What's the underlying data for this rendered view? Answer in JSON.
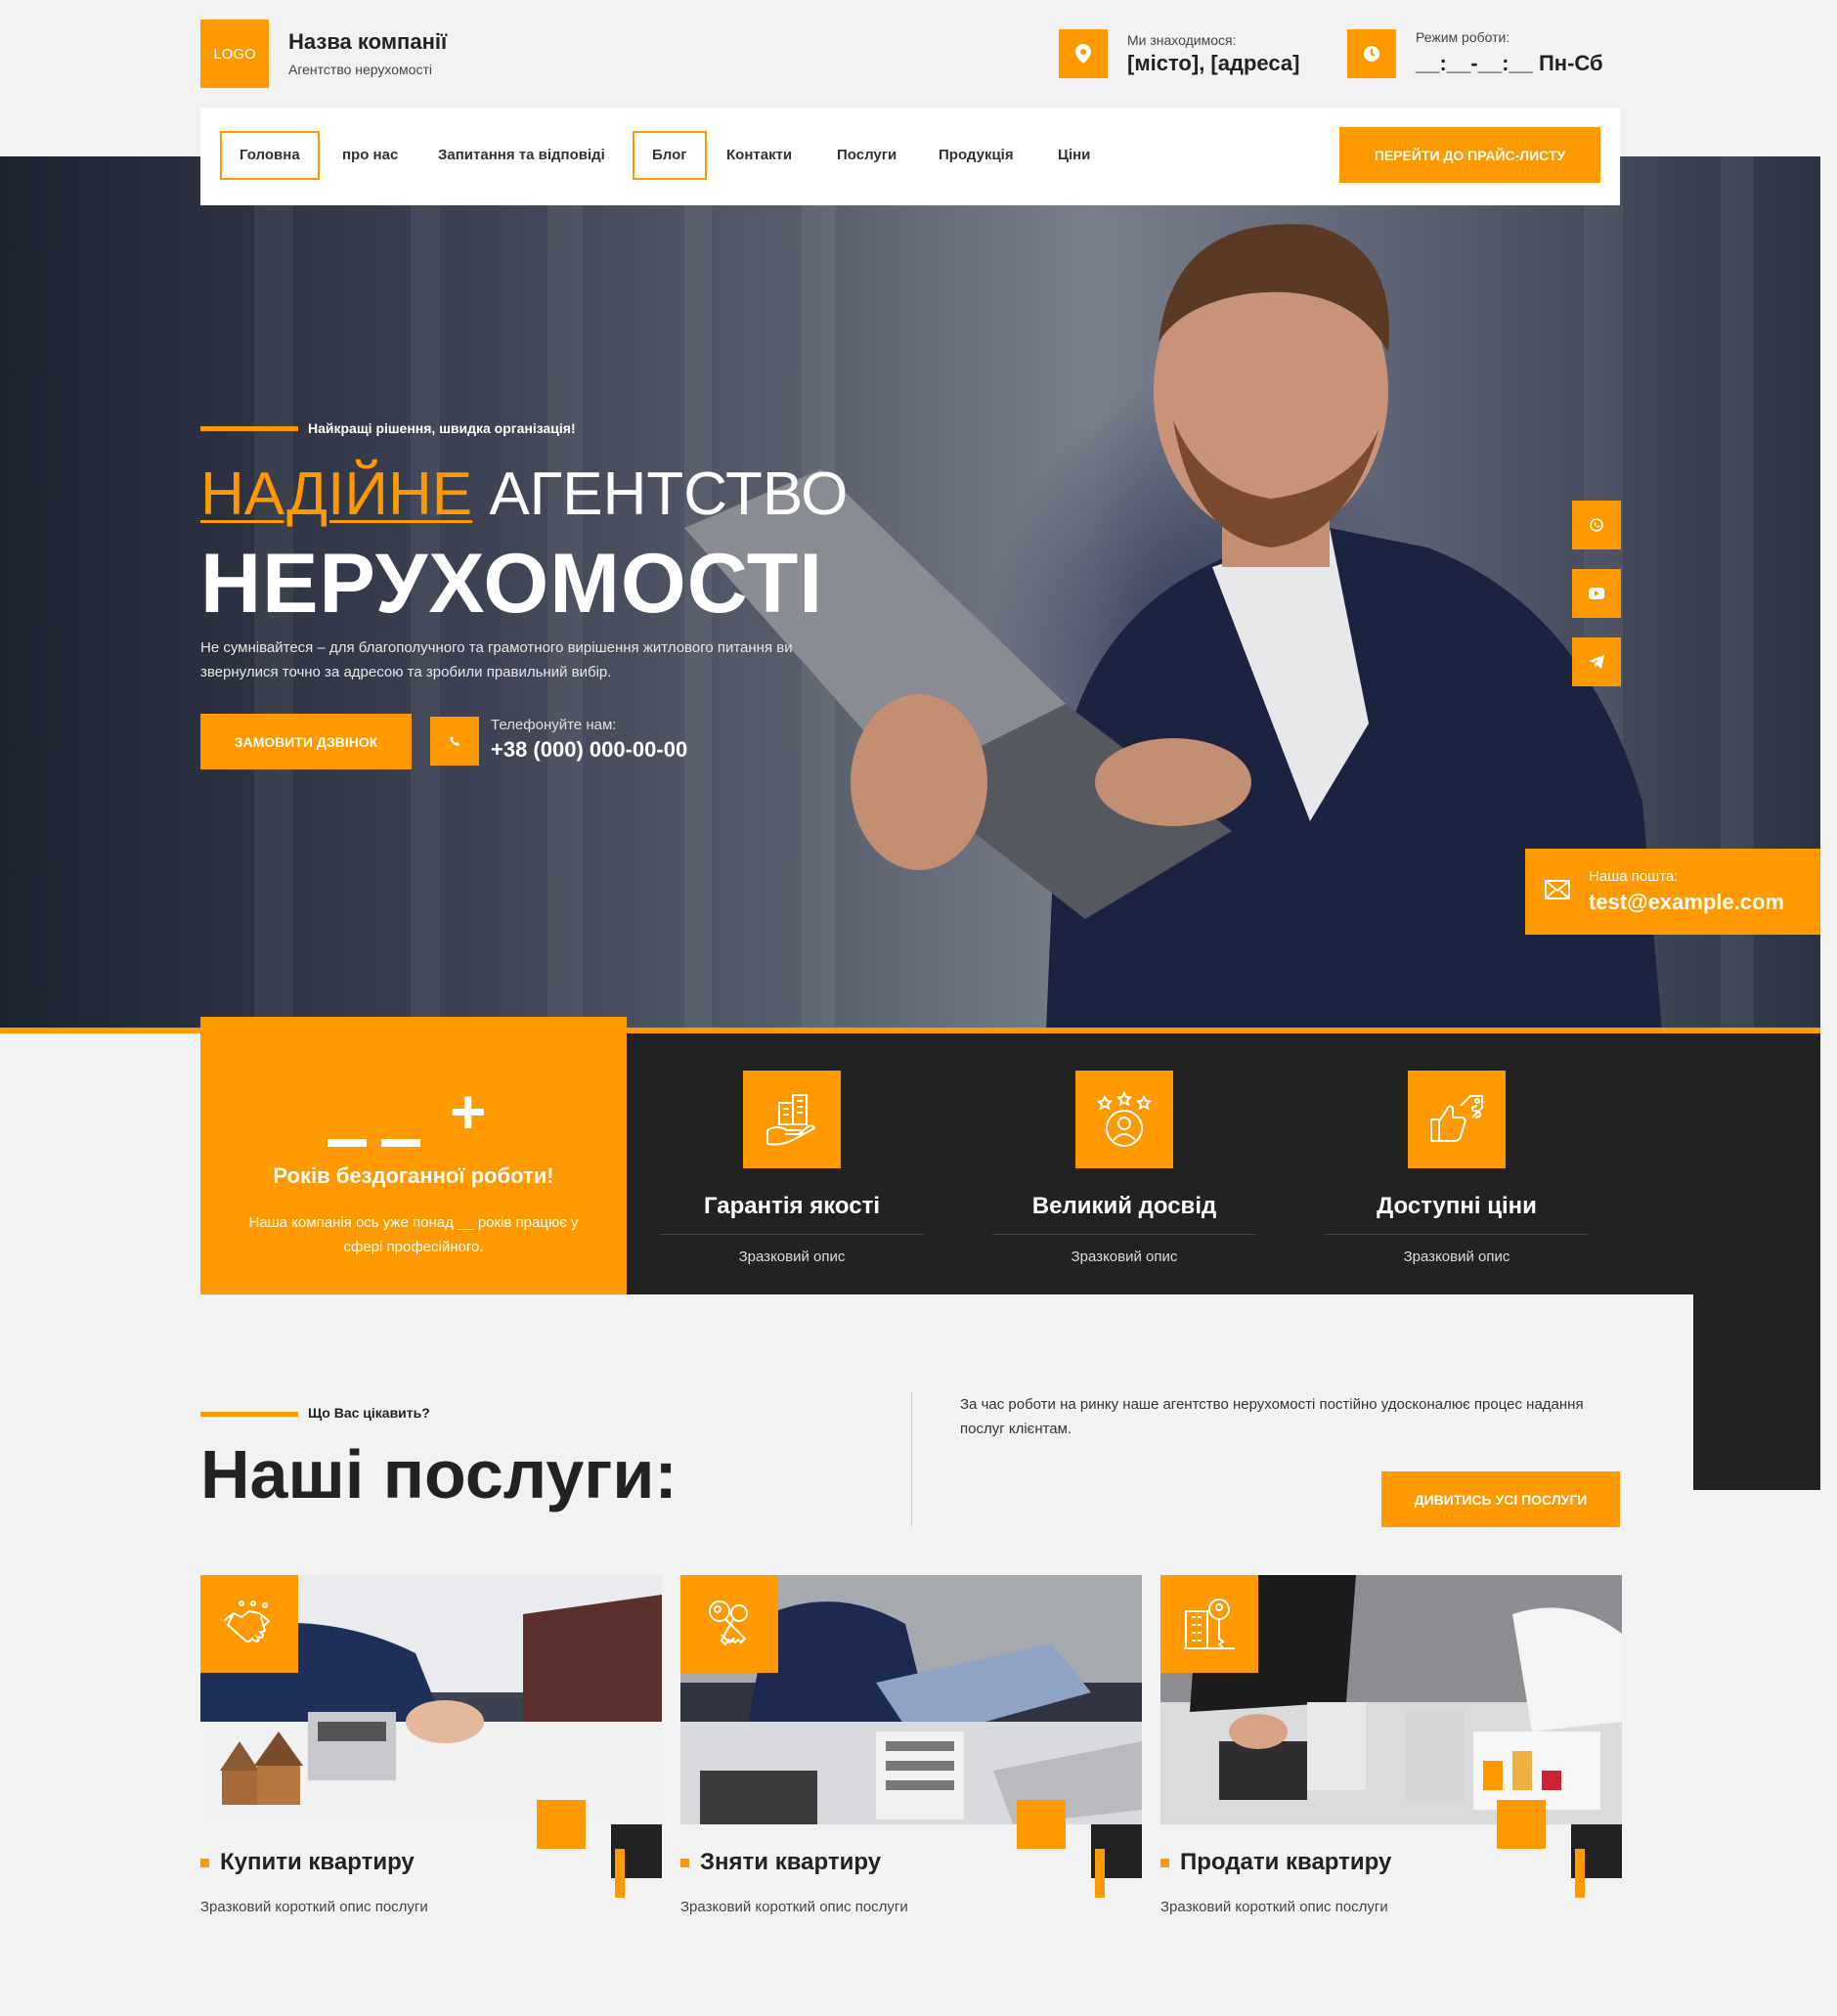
{
  "header": {
    "logo": "LOGO",
    "company_name": "Назва компанії",
    "company_sub": "Агентство нерухомості",
    "location_label": "Ми знаходимося:",
    "location_value": "[місто], [адреса]",
    "hours_label": "Режим роботи:",
    "hours_value": "__:__-__:__ Пн-Сб"
  },
  "nav": {
    "items": [
      "Головна",
      "про нас",
      "Запитання та відповіді",
      "Блог",
      "Контакти",
      "Послуги",
      "Продукція",
      "Ціни"
    ],
    "price_button": "ПЕРЕЙТИ ДО ПРАЙС-ЛИСТУ"
  },
  "hero": {
    "slogan": "Найкращі рішення, швидка організація!",
    "headline_accent": "НАДІЙНЕ",
    "headline_rest": "АГЕНТСТВО",
    "headline_big": "НЕРУХОМОСТІ",
    "description": "Не сумнівайтеся – для благополучного та грамотного вирішення житлового питання ви звернулися точно за адресою та зробили правильний вибір.",
    "call_button": "ЗАМОВИТИ ДЗВІНОК",
    "phone_label": "Телефонуйте нам:",
    "phone_number": "+38 (000) 000-00-00",
    "mail_label": "Наша пошта:",
    "mail_value": "test@example.com"
  },
  "years": {
    "title": "Років бездоганної роботи!",
    "description": "Наша компанія ось уже понад __ років працює у сфері професійного."
  },
  "features": [
    {
      "title": "Гарантія якості",
      "desc": "Зразковий опис",
      "icon": "buildings-hand-icon"
    },
    {
      "title": "Великий досвід",
      "desc": "Зразковий опис",
      "icon": "user-stars-icon"
    },
    {
      "title": "Доступні ціни",
      "desc": "Зразковий опис",
      "icon": "thumb-price-tag-icon"
    }
  ],
  "services": {
    "subtitle": "Що Вас цікавить?",
    "title": "Наші послуги:",
    "description": "За час роботи на ринку наше агентство нерухомості постійно удосконалює процес надання послуг клієнтам.",
    "button": "ДИВИТИСЬ УСІ ПОСЛУГИ",
    "cards": [
      {
        "title": "Купити квартиру",
        "desc": "Зразковий короткий опис послуги",
        "icon": "handshake-icon"
      },
      {
        "title": "Зняти квартиру",
        "desc": "Зразковий короткий опис послуги",
        "icon": "keys-icon"
      },
      {
        "title": "Продати квартиру",
        "desc": "Зразковий короткий опис послуги",
        "icon": "building-key-icon"
      }
    ]
  },
  "colors": {
    "accent": "#ff9900",
    "dark": "#222222",
    "background": "#f2f2f2"
  }
}
